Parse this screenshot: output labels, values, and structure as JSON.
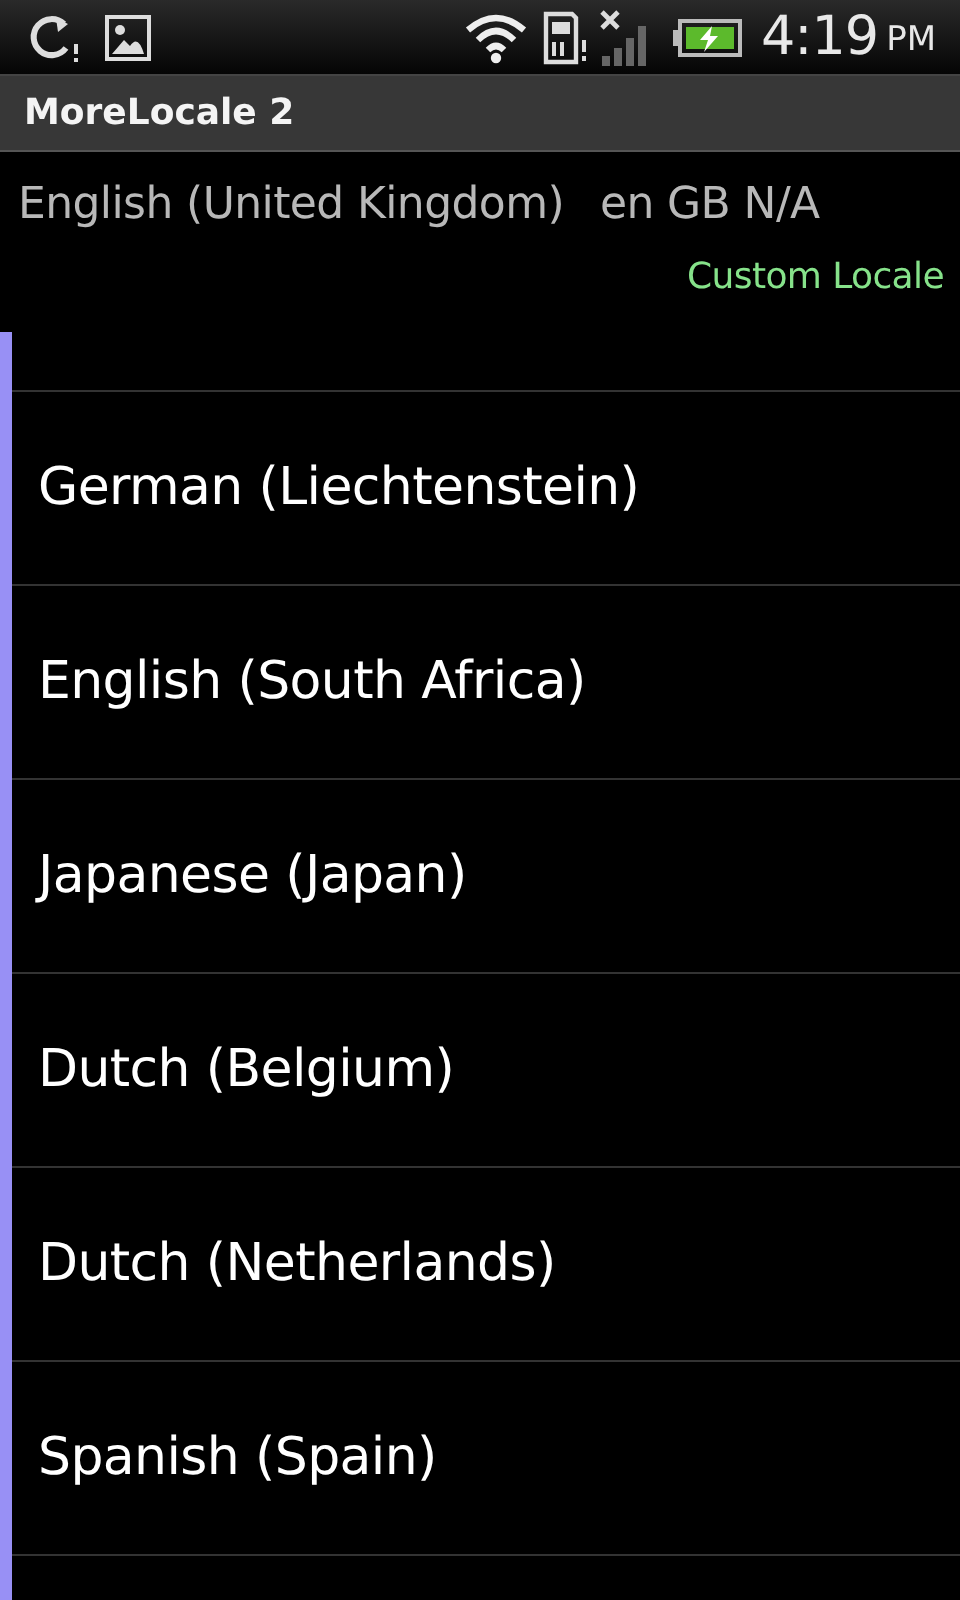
{
  "status_bar": {
    "time": "4:19",
    "period": "PM"
  },
  "window": {
    "title": "MoreLocale 2"
  },
  "current_locale": {
    "name": "English (United Kingdom)",
    "code": "en GB N/A",
    "custom_label": "Custom Locale"
  },
  "locales": [
    {
      "name": "German (Liechtenstein)"
    },
    {
      "name": "English (South Africa)"
    },
    {
      "name": "Japanese (Japan)"
    },
    {
      "name": "Dutch (Belgium)"
    },
    {
      "name": "Dutch (Netherlands)"
    },
    {
      "name": "Spanish (Spain)"
    }
  ]
}
